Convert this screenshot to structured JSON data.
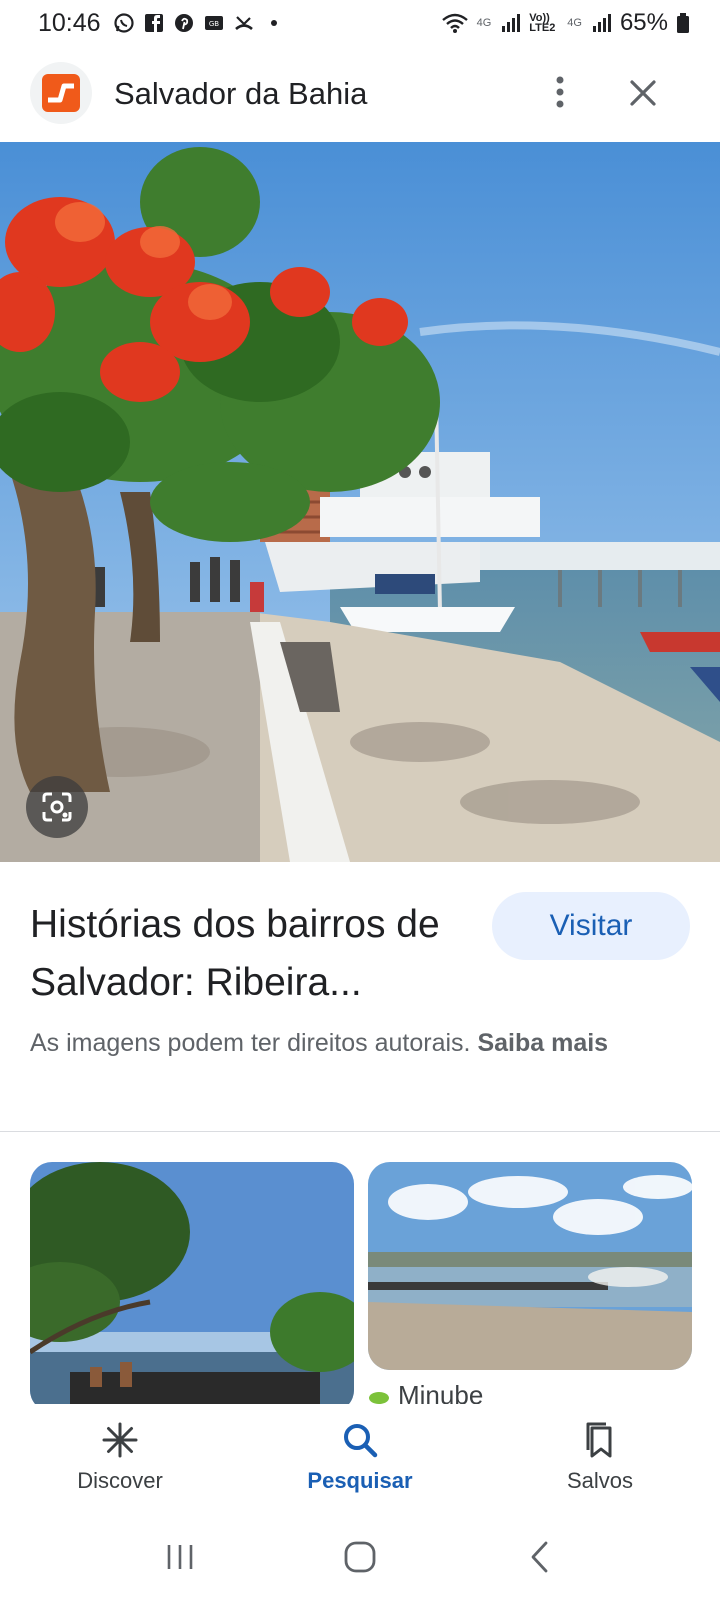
{
  "status_bar": {
    "time": "10:46",
    "network_label_1": "4G",
    "network_label_2": "4G",
    "volte_label": "Vo)) LTE2",
    "battery": "65%"
  },
  "header": {
    "title": "Salvador da Bahia",
    "more_icon": "more-vert-icon",
    "close_icon": "close-icon"
  },
  "result": {
    "title": "Histórias dos bairros de Salvador: Ribeira...",
    "visit_label": "Visitar",
    "copyright_text": "As imagens podem ter direitos autorais.",
    "copyright_link": "Saiba mais"
  },
  "related": {
    "source_name": "Minube"
  },
  "bottom_nav": {
    "items": [
      {
        "label": "Discover",
        "icon": "asterisk-icon",
        "active": false
      },
      {
        "label": "Pesquisar",
        "icon": "search-icon",
        "active": true
      },
      {
        "label": "Salvos",
        "icon": "bookmarks-icon",
        "active": false
      }
    ]
  },
  "colors": {
    "accent": "#1a5fb4",
    "visit_bg": "#e8f0fe",
    "logo_orange": "#f05a1a"
  }
}
